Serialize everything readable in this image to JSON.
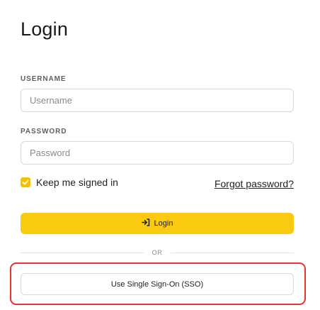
{
  "page": {
    "title": "Login"
  },
  "form": {
    "username": {
      "label": "USERNAME",
      "placeholder": "Username",
      "value": ""
    },
    "password": {
      "label": "PASSWORD",
      "placeholder": "Password",
      "value": ""
    },
    "remember": {
      "label": "Keep me signed in",
      "checked": true
    },
    "forgot_link": "Forgot password?",
    "login_button": {
      "label": "Login",
      "icon": "login-arrow-icon"
    },
    "divider_text": "OR",
    "sso_button": {
      "label": "Use Single Sign-On (SSO)"
    }
  },
  "colors": {
    "accent": "#f9ca0f",
    "highlight": "#e5342a"
  }
}
